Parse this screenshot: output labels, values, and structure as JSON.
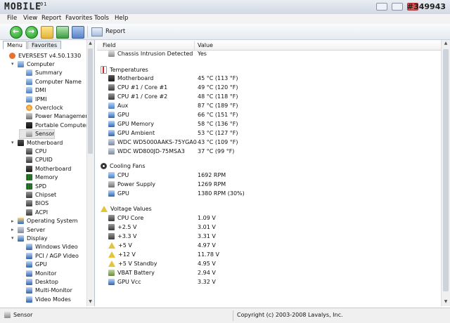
{
  "header": {
    "logo_text": "MOBILE",
    "logo_sub": "01",
    "watermark": "#349943"
  },
  "menubar": [
    "File",
    "View",
    "Report",
    "Favorites",
    "Tools",
    "Help"
  ],
  "toolbar": {
    "report_label": "Report"
  },
  "left": {
    "tabs": [
      "Menu",
      "Favorites"
    ],
    "tree": [
      {
        "label": "EVERSEST v4.50.1330",
        "icon": "info-icon",
        "indent": 0,
        "expander": ""
      },
      {
        "label": "Computer",
        "icon": "computer-icon",
        "indent": 1,
        "expander": "▾"
      },
      {
        "label": "Summary",
        "icon": "computer-icon",
        "indent": 2,
        "expander": ""
      },
      {
        "label": "Computer Name",
        "icon": "computer-icon",
        "indent": 2,
        "expander": ""
      },
      {
        "label": "DMI",
        "icon": "computer-icon",
        "indent": 2,
        "expander": ""
      },
      {
        "label": "IPMI",
        "icon": "computer-icon",
        "indent": 2,
        "expander": ""
      },
      {
        "label": "Overclock",
        "icon": "flame-icon",
        "indent": 2,
        "expander": ""
      },
      {
        "label": "Power Management",
        "icon": "power-icon",
        "indent": 2,
        "expander": ""
      },
      {
        "label": "Portable Computer",
        "icon": "laptop-icon",
        "indent": 2,
        "expander": ""
      },
      {
        "label": "Sensor",
        "icon": "sensor-icon",
        "indent": 2,
        "expander": "",
        "selected": true
      },
      {
        "label": "Motherboard",
        "icon": "motherboard-icon",
        "indent": 1,
        "expander": "▾"
      },
      {
        "label": "CPU",
        "icon": "chip-icon",
        "indent": 2,
        "expander": ""
      },
      {
        "label": "CPUID",
        "icon": "chip-icon",
        "indent": 2,
        "expander": ""
      },
      {
        "label": "Motherboard",
        "icon": "motherboard-icon",
        "indent": 2,
        "expander": ""
      },
      {
        "label": "Memory",
        "icon": "memory-icon",
        "indent": 2,
        "expander": ""
      },
      {
        "label": "SPD",
        "icon": "memory-icon",
        "indent": 2,
        "expander": ""
      },
      {
        "label": "Chipset",
        "icon": "chip-icon",
        "indent": 2,
        "expander": ""
      },
      {
        "label": "BIOS",
        "icon": "chip-icon",
        "indent": 2,
        "expander": ""
      },
      {
        "label": "ACPI",
        "icon": "chip-icon",
        "indent": 2,
        "expander": ""
      },
      {
        "label": "Operating System",
        "icon": "os-icon",
        "indent": 1,
        "expander": "▸"
      },
      {
        "label": "Server",
        "icon": "server-icon",
        "indent": 1,
        "expander": "▸"
      },
      {
        "label": "Display",
        "icon": "display-icon",
        "indent": 1,
        "expander": "▾"
      },
      {
        "label": "Windows Video",
        "icon": "display-icon",
        "indent": 2,
        "expander": ""
      },
      {
        "label": "PCI / AGP Video",
        "icon": "display-icon",
        "indent": 2,
        "expander": ""
      },
      {
        "label": "GPU",
        "icon": "display-icon",
        "indent": 2,
        "expander": ""
      },
      {
        "label": "Monitor",
        "icon": "display-icon",
        "indent": 2,
        "expander": ""
      },
      {
        "label": "Desktop",
        "icon": "display-icon",
        "indent": 2,
        "expander": ""
      },
      {
        "label": "Multi-Monitor",
        "icon": "display-icon",
        "indent": 2,
        "expander": ""
      },
      {
        "label": "Video Modes",
        "icon": "display-icon",
        "indent": 2,
        "expander": ""
      }
    ]
  },
  "table": {
    "columns": {
      "field": "Field",
      "value": "Value"
    },
    "rows": [
      {
        "type": "row",
        "field": "Chassis Intrusion Detected",
        "value": "Yes",
        "icon": "sensor-icon"
      },
      {
        "type": "blank"
      },
      {
        "type": "section",
        "field": "Temperatures",
        "icon": "thermometer-icon"
      },
      {
        "type": "row",
        "field": "Motherboard",
        "value": "45 °C  (113 °F)",
        "icon": "motherboard-icon"
      },
      {
        "type": "row",
        "field": "CPU #1 / Core #1",
        "value": "49 °C  (120 °F)",
        "icon": "chip-icon"
      },
      {
        "type": "row",
        "field": "CPU #1 / Core #2",
        "value": "48 °C  (118 °F)",
        "icon": "chip-icon"
      },
      {
        "type": "row",
        "field": "Aux",
        "value": "87 °C  (189 °F)",
        "icon": "computer-icon"
      },
      {
        "type": "row",
        "field": "GPU",
        "value": "66 °C  (151 °F)",
        "icon": "display-icon"
      },
      {
        "type": "row",
        "field": "GPU Memory",
        "value": "58 °C  (136 °F)",
        "icon": "display-icon"
      },
      {
        "type": "row",
        "field": "GPU Ambient",
        "value": "53 °C  (127 °F)",
        "icon": "display-icon"
      },
      {
        "type": "row",
        "field": "WDC WD5000AAKS-75YGA0",
        "value": "43 °C  (109 °F)",
        "icon": "server-icon"
      },
      {
        "type": "row",
        "field": "WDC WD800JD-75MSA3",
        "value": "37 °C  (99 °F)",
        "icon": "server-icon"
      },
      {
        "type": "blank"
      },
      {
        "type": "section",
        "field": "Cooling Fans",
        "icon": "fan-icon"
      },
      {
        "type": "row",
        "field": "CPU",
        "value": "1692 RPM",
        "icon": "computer-icon"
      },
      {
        "type": "row",
        "field": "Power Supply",
        "value": "1269 RPM",
        "icon": "power-icon"
      },
      {
        "type": "row",
        "field": "GPU",
        "value": "1380 RPM  (30%)",
        "icon": "display-icon"
      },
      {
        "type": "blank"
      },
      {
        "type": "section",
        "field": "Voltage Values",
        "icon": "warning-icon"
      },
      {
        "type": "row",
        "field": "CPU Core",
        "value": "1.09 V",
        "icon": "chip-icon"
      },
      {
        "type": "row",
        "field": "+2.5 V",
        "value": "3.01 V",
        "icon": "chip-icon"
      },
      {
        "type": "row",
        "field": "+3.3 V",
        "value": "3.31 V",
        "icon": "chip-icon"
      },
      {
        "type": "row",
        "field": "+5 V",
        "value": "4.97 V",
        "icon": "warning-icon"
      },
      {
        "type": "row",
        "field": "+12 V",
        "value": "11.78 V",
        "icon": "warning-icon"
      },
      {
        "type": "row",
        "field": "+5 V Standby",
        "value": "4.95 V",
        "icon": "warning-icon"
      },
      {
        "type": "row",
        "field": "VBAT Battery",
        "value": "2.94 V",
        "icon": "battery-icon"
      },
      {
        "type": "row",
        "field": "GPU Vcc",
        "value": "3.32 V",
        "icon": "display-icon"
      }
    ]
  },
  "status": {
    "left": "Sensor",
    "right": "Copyright (c) 2003-2008 Lavalys, Inc."
  }
}
